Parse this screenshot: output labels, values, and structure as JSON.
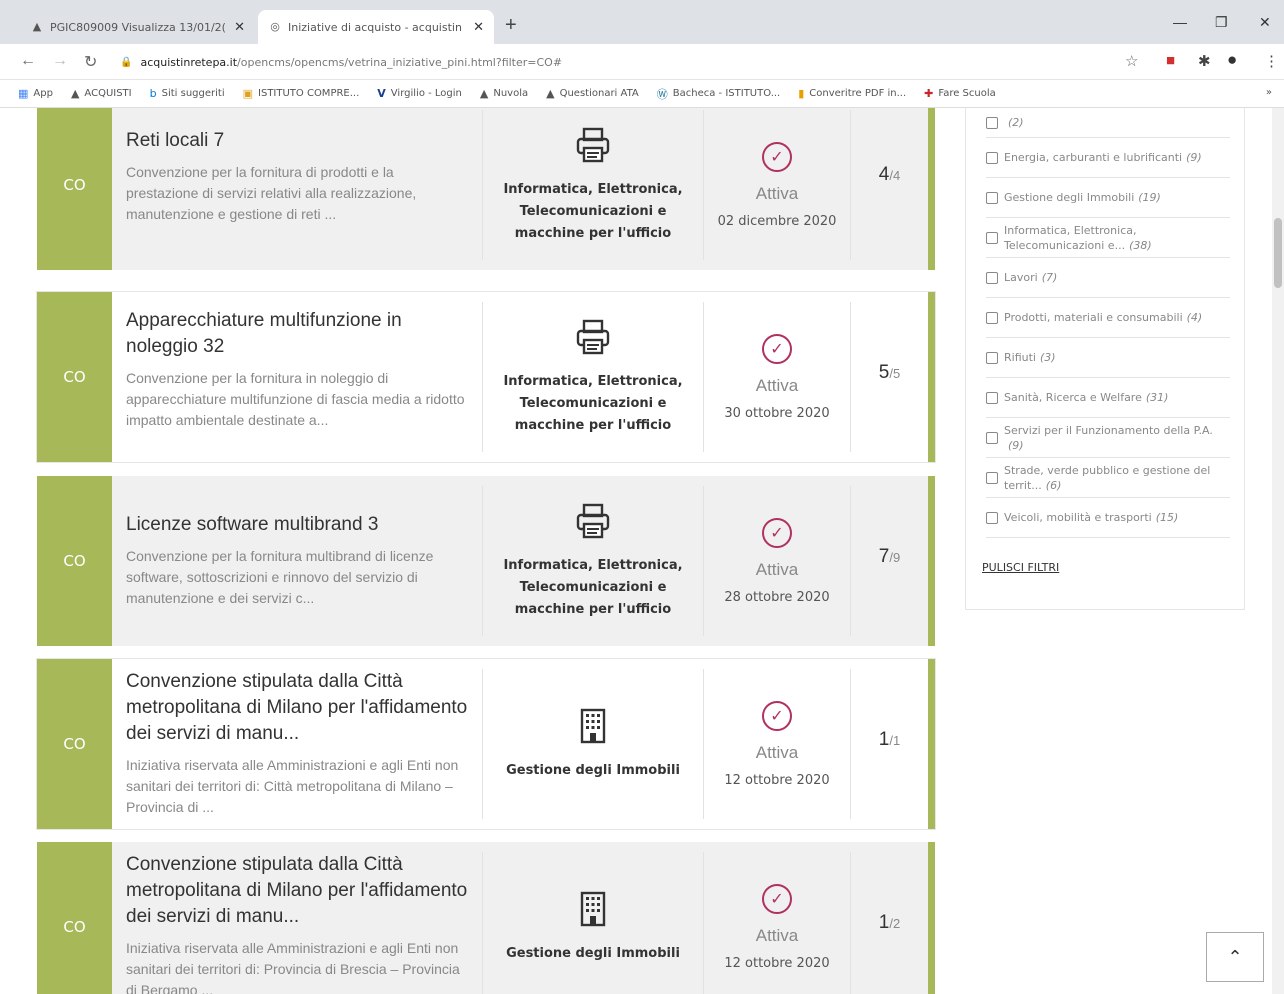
{
  "browser": {
    "tabs": [
      {
        "title": "PGIC809009 Visualizza 13/01/2(",
        "icon": "drive-icon",
        "active": false
      },
      {
        "title": "Iniziative di acquisto - acquistin",
        "icon": "globe-icon",
        "active": true
      }
    ],
    "url_host": "acquistinretepa.it",
    "url_path": "/opencms/opencms/vetrina_iniziative_pini.html?filter=CO#",
    "bookmarks": [
      {
        "label": "App",
        "icon": "apps-icon"
      },
      {
        "label": "ACQUISTI",
        "icon": "drive-icon"
      },
      {
        "label": "Siti suggeriti",
        "icon": "bing-icon"
      },
      {
        "label": "ISTITUTO COMPRE...",
        "icon": "school-icon"
      },
      {
        "label": "Virgilio - Login",
        "icon": "virgilio-icon"
      },
      {
        "label": "Nuvola",
        "icon": "drive-icon"
      },
      {
        "label": "Questionari ATA",
        "icon": "drive-icon"
      },
      {
        "label": "Bacheca - ISTITUTO...",
        "icon": "wordpress-icon"
      },
      {
        "label": "Converitre PDF in...",
        "icon": "pdf-icon"
      },
      {
        "label": "Fare Scuola",
        "icon": "fare-scuola-icon"
      }
    ],
    "bookmarks_more": "»"
  },
  "cards": [
    {
      "badge": "CO",
      "title": "Reti locali 7",
      "description": "Convenzione per la fornitura di prodotti e la prestazione di servizi relativi alla realizzazione, manutenzione e gestione di reti ...",
      "category": "Informatica, Elettronica, Telecomunicazioni e macchine per l'ufficio",
      "category_icon": "printer-icon",
      "status": "Attiva",
      "date": "02 dicembre 2020",
      "count_big": "4",
      "count_small": "/4"
    },
    {
      "badge": "CO",
      "title": "Apparecchiature multifunzione in noleggio 32",
      "description": "Convenzione per la fornitura in noleggio di apparecchiature multifunzione di fascia media a ridotto impatto ambientale destinate a...",
      "category": "Informatica, Elettronica, Telecomunicazioni e macchine per l'ufficio",
      "category_icon": "printer-icon",
      "status": "Attiva",
      "date": "30 ottobre 2020",
      "count_big": "5",
      "count_small": "/5"
    },
    {
      "badge": "CO",
      "title": "Licenze software multibrand 3",
      "description": "Convenzione per la fornitura multibrand di licenze software, sottoscrizioni e rinnovo del servizio di manutenzione e dei servizi c...",
      "category": "Informatica, Elettronica, Telecomunicazioni e macchine per l'ufficio",
      "category_icon": "printer-icon",
      "status": "Attiva",
      "date": "28 ottobre 2020",
      "count_big": "7",
      "count_small": "/9"
    },
    {
      "badge": "CO",
      "title": "Convenzione stipulata dalla Città metropolitana di Milano per l'affidamento dei servizi di manu...",
      "description": "Iniziativa riservata alle Amministrazioni e agli Enti non sanitari dei territori di: Città metropolitana di Milano – Provincia di ...",
      "category": "Gestione degli Immobili",
      "category_icon": "building-icon",
      "status": "Attiva",
      "date": "12 ottobre 2020",
      "count_big": "1",
      "count_small": "/1"
    },
    {
      "badge": "CO",
      "title": "Convenzione stipulata dalla Città metropolitana di Milano per l'affidamento dei servizi di manu...",
      "description": "Iniziativa riservata alle Amministrazioni e agli Enti non sanitari dei territori di: Provincia di Brescia – Provincia di Bergamo ...",
      "category": "Gestione degli Immobili",
      "category_icon": "building-icon",
      "status": "Attiva",
      "date": "12 ottobre 2020",
      "count_big": "1",
      "count_small": "/2"
    }
  ],
  "filters": {
    "items": [
      {
        "label": "",
        "count": "(2)"
      },
      {
        "label": "Energia, carburanti e lubrificanti",
        "count": "(9)"
      },
      {
        "label": "Gestione degli Immobili",
        "count": "(19)"
      },
      {
        "label": "Informatica, Elettronica, Telecomunicazioni e...",
        "count": "(38)"
      },
      {
        "label": "Lavori",
        "count": "(7)"
      },
      {
        "label": "Prodotti, materiali e consumabili",
        "count": "(4)"
      },
      {
        "label": "Rifiuti",
        "count": "(3)"
      },
      {
        "label": "Sanità, Ricerca e Welfare",
        "count": "(31)"
      },
      {
        "label": "Servizi per il Funzionamento della P.A.",
        "count": "(9)"
      },
      {
        "label": "Strade, verde pubblico e gestione del territ...",
        "count": "(6)"
      },
      {
        "label": "Veicoli, mobilità e trasporti",
        "count": "(15)"
      }
    ],
    "clear_label": "PULISCI FILTRI"
  },
  "colors": {
    "accent_green": "#a6b858",
    "status_magenta": "#b03060"
  }
}
